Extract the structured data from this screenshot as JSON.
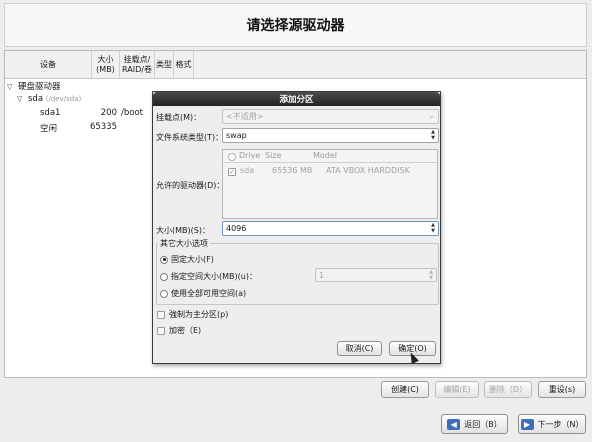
{
  "header": {
    "title": "请选择源驱动器"
  },
  "table": {
    "columns": {
      "device": "设备",
      "size": "大小\n(MB)",
      "mount": "挂载点/\nRAID/卷",
      "type": "类型",
      "format": "格式"
    },
    "tree": {
      "root": "硬盘驱动器",
      "disk_name": "sda",
      "disk_path": "(/dev/sda)",
      "rows": [
        {
          "name": "sda1",
          "size": "200",
          "mount": "/boot"
        },
        {
          "name": "空闲",
          "size": "65335",
          "mount": ""
        }
      ]
    }
  },
  "buttons": {
    "create": "创建(C)",
    "edit": "编辑(E)",
    "delete": "删除（D）",
    "reset": "重设(s)",
    "back": "返回（B）",
    "next": "下一步（N）"
  },
  "dialog": {
    "title": "添加分区",
    "mount_label": "挂载点(M)：",
    "mount_placeholder": "<不适用>",
    "fstype_label": "文件系统类型(T)：",
    "fstype_value": "swap",
    "drives_label": "允许的驱动器(D)：",
    "drives": {
      "headers": {
        "drive": "Drive",
        "size": "Size",
        "model": "Model"
      },
      "rows": [
        {
          "drive": "sda",
          "size": "65536 MB",
          "model": "ATA VBOX HARDDISK"
        }
      ]
    },
    "size_label": "大小(MB)(S)：",
    "size_value": "4096",
    "other_size_title": "其它大小选项",
    "options": {
      "fixed": "固定大小(F)",
      "up_to": "指定空间大小(MB)(u)：",
      "up_to_value": "1",
      "fill": "使用全部可用空间(a)"
    },
    "force_primary": "強制为主分区(p)",
    "encrypt": "加密（E)",
    "cancel": "取消(C)",
    "ok": "确定(O)"
  }
}
